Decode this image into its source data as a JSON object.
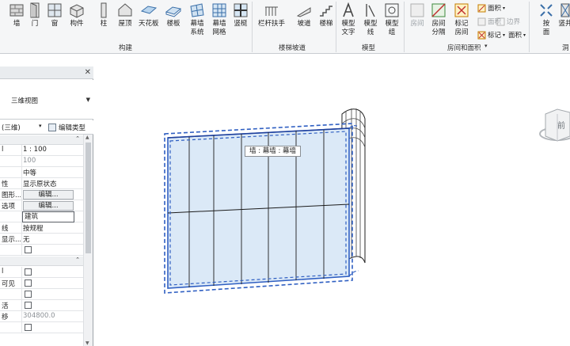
{
  "ribbon": {
    "buttons": [
      {
        "name": "wall",
        "label": "墙",
        "label2": "",
        "icon": "wall-icon"
      },
      {
        "name": "door",
        "label": "门",
        "label2": "",
        "icon": "door-icon"
      },
      {
        "name": "window",
        "label": "窗",
        "label2": "",
        "icon": "window-icon"
      },
      {
        "name": "component",
        "label": "构件",
        "label2": "",
        "icon": "component-icon"
      },
      {
        "name": "column",
        "label": "柱",
        "label2": "",
        "icon": "column-icon"
      },
      {
        "name": "roof",
        "label": "屋顶",
        "label2": "",
        "icon": "roof-icon"
      },
      {
        "name": "ceiling",
        "label": "天花板",
        "label2": "",
        "icon": "ceiling-icon"
      },
      {
        "name": "floor",
        "label": "楼板",
        "label2": "",
        "icon": "floor-icon"
      },
      {
        "name": "curtain-system",
        "label": "幕墙",
        "label2": "系统",
        "icon": "curtain-system-icon"
      },
      {
        "name": "curtain-grid",
        "label": "幕墙",
        "label2": "网格",
        "icon": "curtain-grid-icon"
      },
      {
        "name": "mullion",
        "label": "竖梃",
        "label2": "",
        "icon": "mullion-icon"
      },
      {
        "name": "railing",
        "label": "栏杆扶手",
        "label2": "",
        "icon": "railing-icon"
      },
      {
        "name": "ramp",
        "label": "坡道",
        "label2": "",
        "icon": "ramp-icon"
      },
      {
        "name": "stair",
        "label": "楼梯",
        "label2": "",
        "icon": "stair-icon"
      },
      {
        "name": "model-text",
        "label": "模型",
        "label2": "文字",
        "icon": "model-text-icon"
      },
      {
        "name": "model-line",
        "label": "模型",
        "label2": "线",
        "icon": "model-line-icon"
      },
      {
        "name": "model-group",
        "label": "模型",
        "label2": "组",
        "icon": "model-group-icon"
      },
      {
        "name": "room",
        "label": "房间",
        "label2": "",
        "icon": "room-icon"
      },
      {
        "name": "room-separator",
        "label": "房间",
        "label2": "分隔",
        "icon": "room-separator-icon"
      },
      {
        "name": "tag-room",
        "label": "标记",
        "label2": "房间",
        "icon": "tag-room-icon"
      },
      {
        "name": "by-face",
        "label": "按",
        "label2": "面",
        "icon": "by-face-icon"
      },
      {
        "name": "shaft",
        "label": "竖井",
        "label2": "",
        "icon": "shaft-icon"
      }
    ],
    "small": {
      "area": "面积",
      "area_plan": "面积",
      "area_boundary": "边界",
      "tag_area": "标记",
      "tag_area2": "面积"
    },
    "groups": {
      "build": "构建",
      "circulation": "楼梯坡道",
      "model": "模型",
      "room_area": "房间和面积",
      "opening": "洞"
    }
  },
  "properties": {
    "type_name": "三维视图",
    "instance_label": "(三维)",
    "edit_type": "编辑类型",
    "rows": [
      {
        "key": "l",
        "value": "1 : 100",
        "kind": "text"
      },
      {
        "key": "",
        "value": "100",
        "kind": "grey"
      },
      {
        "key": "",
        "value": "中等",
        "kind": "text"
      },
      {
        "key": "性",
        "value": "显示原状态",
        "kind": "text"
      },
      {
        "key": "图形...",
        "value": "编辑...",
        "kind": "button"
      },
      {
        "key": "选项",
        "value": "编辑...",
        "kind": "button"
      },
      {
        "key": "",
        "value": "建筑",
        "kind": "input"
      },
      {
        "key": "线",
        "value": "按规程",
        "kind": "text"
      },
      {
        "key": "显示...",
        "value": "无",
        "kind": "text"
      },
      {
        "key": "",
        "value": "",
        "kind": "check"
      }
    ],
    "rows2": [
      {
        "key": "l",
        "value": "",
        "kind": "check"
      },
      {
        "key": "可见",
        "value": "",
        "kind": "check"
      },
      {
        "key": "",
        "value": "",
        "kind": "check"
      },
      {
        "key": "活",
        "value": "",
        "kind": "check"
      },
      {
        "key": "移",
        "value": "304800.0",
        "kind": "grey"
      },
      {
        "key": "",
        "value": "",
        "kind": "check"
      }
    ]
  },
  "canvas": {
    "tooltip": "墙 : 幕墙 : 幕墙",
    "viewcube_face": "前"
  },
  "colors": {
    "ribbon_bg": "#f5f6f7",
    "selection": "#2f5fc2",
    "panel_fill": "#dbe9f7"
  }
}
